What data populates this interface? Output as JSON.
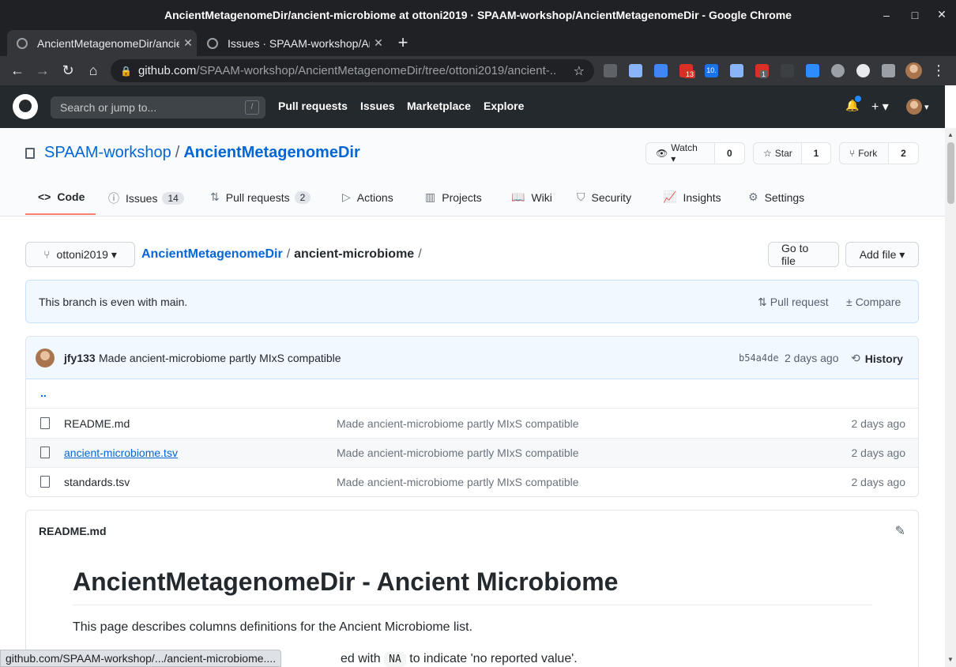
{
  "window": {
    "title": "AncientMetagenomeDir/ancient-microbiome at ottoni2019 · SPAAM-workshop/AncientMetagenomeDir - Google Chrome",
    "min_icon": "–",
    "max_icon": "□",
    "close_icon": "✕"
  },
  "tabs": [
    {
      "label": "AncientMetagenomeDir/ancient-microbiome",
      "close": "✕"
    },
    {
      "label": "Issues · SPAAM-workshop/AncientMetagenomeDir",
      "close": "✕"
    }
  ],
  "new_tab": "+",
  "browser": {
    "url_host": "github.com",
    "url_path": "/SPAAM-workshop/AncientMetagenomeDir/tree/ottoni2019/ancient-...",
    "back": "←",
    "forward": "→",
    "reload": "↻",
    "home": "⌂",
    "lock": "🔒",
    "bookmark": "☆",
    "menu": "⋮",
    "ext_badges": [
      "13",
      "10.",
      "1"
    ]
  },
  "github_header": {
    "search_placeholder": "Search or jump to...",
    "search_key": "/",
    "nav": [
      "Pull requests",
      "Issues",
      "Marketplace",
      "Explore"
    ],
    "bell": "🔔",
    "plus": "+ ▾",
    "caret": "▾"
  },
  "repo": {
    "owner": "SPAAM-workshop",
    "separator": "/",
    "name": "AncientMetagenomeDir",
    "watch": {
      "icon": "👁",
      "label": "Watch ▾",
      "count": "0"
    },
    "star": {
      "icon": "☆",
      "label": "Star",
      "count": "1"
    },
    "fork": {
      "icon": "⑂",
      "label": "Fork",
      "count": "2"
    }
  },
  "repo_tabs": [
    {
      "icon": "<>",
      "label": "Code",
      "badge": ""
    },
    {
      "icon": "ⓘ",
      "label": "Issues",
      "badge": "14"
    },
    {
      "icon": "⇅",
      "label": "Pull requests",
      "badge": "2"
    },
    {
      "icon": "▷",
      "label": "Actions",
      "badge": ""
    },
    {
      "icon": "▥",
      "label": "Projects",
      "badge": ""
    },
    {
      "icon": "📖",
      "label": "Wiki",
      "badge": ""
    },
    {
      "icon": "⛉",
      "label": "Security",
      "badge": ""
    },
    {
      "icon": "📈",
      "label": "Insights",
      "badge": ""
    },
    {
      "icon": "⚙",
      "label": "Settings",
      "badge": ""
    }
  ],
  "branch": {
    "icon": "⑂",
    "label": "ottoni2019 ▾"
  },
  "breadcrumb": {
    "repo": "AncientMetagenomeDir",
    "sep": "/",
    "dir": "ancient-microbiome",
    "trail": "/"
  },
  "actions": {
    "go_to_file": "Go to file",
    "add_file": "Add file ▾"
  },
  "branch_status": {
    "message": "This branch is even with main.",
    "pull_request_icon": "⇅",
    "pull_request": "Pull request",
    "compare_icon": "±",
    "compare": "Compare"
  },
  "latest_commit": {
    "author": "jfy133",
    "message": "Made ancient-microbiome partly MIxS compatible",
    "sha": "b54a4de",
    "age": "2 days ago",
    "history_icon": "⟲",
    "history": "History"
  },
  "parent_dir": "..",
  "files": [
    {
      "name": "README.md",
      "message": "Made ancient-microbiome partly MIxS compatible",
      "age": "2 days ago"
    },
    {
      "name": "ancient-microbiome.tsv",
      "message": "Made ancient-microbiome partly MIxS compatible",
      "age": "2 days ago"
    },
    {
      "name": "standards.tsv",
      "message": "Made ancient-microbiome partly MIxS compatible",
      "age": "2 days ago"
    }
  ],
  "readme": {
    "filename": "README.md",
    "edit_icon": "✎",
    "heading": "AncientMetagenomeDir - Ancient Microbiome",
    "para1": "This page describes columns definitions for the Ancient Microbiome list.",
    "para2_a": "ed with ",
    "para2_code": "NA",
    "para2_b": " to indicate 'no reported value'."
  },
  "status_url": "github.com/SPAAM-workshop/.../ancient-microbiome....",
  "scroll": {
    "up": "▲",
    "down": "▼"
  }
}
